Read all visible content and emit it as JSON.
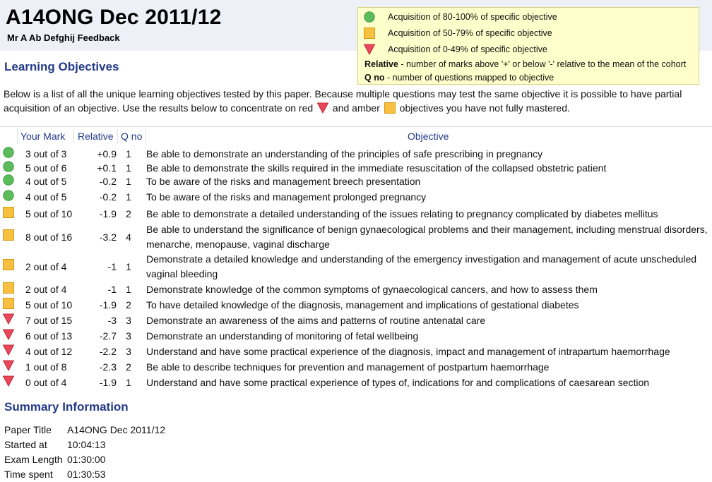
{
  "header": {
    "title": "A14ONG Dec 2011/12",
    "candidate": "Mr A Ab Defghij Feedback"
  },
  "legend": {
    "items": [
      {
        "icon": "green-circle-icon",
        "text": "Acquisition of 80-100% of specific objective"
      },
      {
        "icon": "amber-square-icon",
        "text": "Acquisition of 50-79% of specific objective"
      },
      {
        "icon": "red-triangle-icon",
        "text": "Acquisition of 0-49% of specific objective"
      }
    ],
    "relative_term": "Relative",
    "relative_desc": " - number of marks above '+' or below '-' relative to the mean of the cohort",
    "qno_term": "Q no",
    "qno_desc": " - number of questions mapped to objective"
  },
  "colors": {
    "heading": "#243a8a",
    "green": "#5cbc5c",
    "amber": "#f8c040",
    "red": "#e8485a",
    "legend_bg": "#ffffcc"
  },
  "learning": {
    "heading": "Learning Objectives",
    "intro_part1": "Below is a list of all the unique learning objectives tested by this paper. Because multiple questions may test the same objective it is possible to have partial acquisition of an objective. Use the results below to concentrate on red ",
    "intro_part2": " and amber ",
    "intro_part3": " objectives you have not fully mastered."
  },
  "table": {
    "columns": [
      "Your Mark",
      "Relative",
      "Q no",
      "Objective"
    ],
    "rows": [
      {
        "status": "green",
        "mark": "3 out of 3",
        "relative": "+0.9",
        "qno": "1",
        "objective": "Be able to demonstrate an understanding of the principles of safe prescribing in pregnancy"
      },
      {
        "status": "green",
        "mark": "5 out of 6",
        "relative": "+0.1",
        "qno": "1",
        "objective": "Be able to demonstrate the skills required in the immediate resuscitation of the collapsed obstetric patient"
      },
      {
        "status": "green",
        "mark": "4 out of 5",
        "relative": "-0.2",
        "qno": "1",
        "objective": "To be aware of the risks and management breech presentation"
      },
      {
        "status": "green",
        "mark": "4 out of 5",
        "relative": "-0.2",
        "qno": "1",
        "objective": "To be aware of the risks and management prolonged pregnancy"
      },
      {
        "status": "amber",
        "mark": "5 out of 10",
        "relative": "-1.9",
        "qno": "2",
        "objective": "Be able to demonstrate a detailed understanding of the issues relating to pregnancy complicated by diabetes mellitus"
      },
      {
        "status": "amber",
        "mark": "8 out of 16",
        "relative": "-3.2",
        "qno": "4",
        "objective": "Be able to understand the significance of benign gynaecological problems and their management, including menstrual disorders, menarche, menopause, vaginal discharge"
      },
      {
        "status": "amber",
        "mark": "2 out of 4",
        "relative": "-1",
        "qno": "1",
        "objective": "Demonstrate a detailed knowledge and understanding of the emergency investigation and management of acute unscheduled vaginal bleeding"
      },
      {
        "status": "amber",
        "mark": "2 out of 4",
        "relative": "-1",
        "qno": "1",
        "objective": "Demonstrate knowledge of the common symptoms of gynaecological cancers, and how to assess them"
      },
      {
        "status": "amber",
        "mark": "5 out of 10",
        "relative": "-1.9",
        "qno": "2",
        "objective": "To have detailed knowledge of the diagnosis, management and implications of gestational diabetes"
      },
      {
        "status": "red",
        "mark": "7 out of 15",
        "relative": "-3",
        "qno": "3",
        "objective": "Demonstrate an awareness of the aims and patterns of routine antenatal care"
      },
      {
        "status": "red",
        "mark": "6 out of 13",
        "relative": "-2.7",
        "qno": "3",
        "objective": "Demonstrate an understanding of monitoring of fetal wellbeing"
      },
      {
        "status": "red",
        "mark": "4 out of 12",
        "relative": "-2.2",
        "qno": "3",
        "objective": "Understand and have some practical experience of the diagnosis, impact and management of intrapartum haemorrhage"
      },
      {
        "status": "red",
        "mark": "1 out of 8",
        "relative": "-2.3",
        "qno": "2",
        "objective": "Be able to describe techniques for prevention and management of postpartum haemorrhage"
      },
      {
        "status": "red",
        "mark": "0 out of 4",
        "relative": "-1.9",
        "qno": "1",
        "objective": "Understand and have some practical experience of types of, indications for and complications of caesarean section"
      }
    ]
  },
  "summary": {
    "heading": "Summary Information",
    "items": [
      {
        "label": "Paper Title",
        "value": "A14ONG Dec 2011/12"
      },
      {
        "label": "Started at",
        "value": "10:04:13"
      },
      {
        "label": "Exam Length",
        "value": "01:30:00"
      },
      {
        "label": "Time spent",
        "value": "01:30:53"
      }
    ]
  }
}
